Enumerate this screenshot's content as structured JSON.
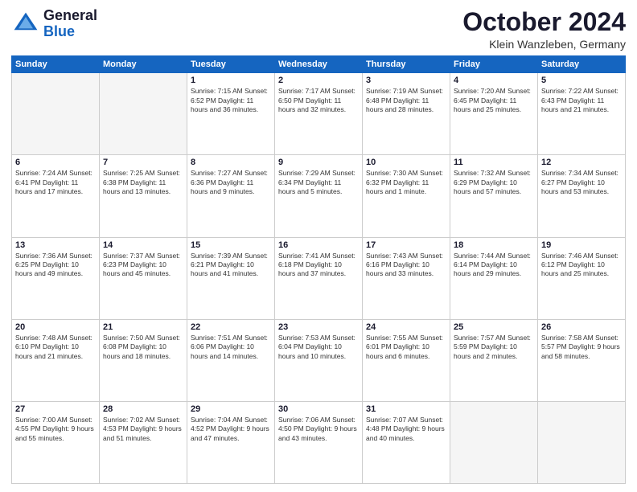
{
  "header": {
    "logo_general": "General",
    "logo_blue": "Blue",
    "month_title": "October 2024",
    "location": "Klein Wanzleben, Germany"
  },
  "weekdays": [
    "Sunday",
    "Monday",
    "Tuesday",
    "Wednesday",
    "Thursday",
    "Friday",
    "Saturday"
  ],
  "weeks": [
    [
      {
        "day": "",
        "info": ""
      },
      {
        "day": "",
        "info": ""
      },
      {
        "day": "1",
        "info": "Sunrise: 7:15 AM\nSunset: 6:52 PM\nDaylight: 11 hours\nand 36 minutes."
      },
      {
        "day": "2",
        "info": "Sunrise: 7:17 AM\nSunset: 6:50 PM\nDaylight: 11 hours\nand 32 minutes."
      },
      {
        "day": "3",
        "info": "Sunrise: 7:19 AM\nSunset: 6:48 PM\nDaylight: 11 hours\nand 28 minutes."
      },
      {
        "day": "4",
        "info": "Sunrise: 7:20 AM\nSunset: 6:45 PM\nDaylight: 11 hours\nand 25 minutes."
      },
      {
        "day": "5",
        "info": "Sunrise: 7:22 AM\nSunset: 6:43 PM\nDaylight: 11 hours\nand 21 minutes."
      }
    ],
    [
      {
        "day": "6",
        "info": "Sunrise: 7:24 AM\nSunset: 6:41 PM\nDaylight: 11 hours\nand 17 minutes."
      },
      {
        "day": "7",
        "info": "Sunrise: 7:25 AM\nSunset: 6:38 PM\nDaylight: 11 hours\nand 13 minutes."
      },
      {
        "day": "8",
        "info": "Sunrise: 7:27 AM\nSunset: 6:36 PM\nDaylight: 11 hours\nand 9 minutes."
      },
      {
        "day": "9",
        "info": "Sunrise: 7:29 AM\nSunset: 6:34 PM\nDaylight: 11 hours\nand 5 minutes."
      },
      {
        "day": "10",
        "info": "Sunrise: 7:30 AM\nSunset: 6:32 PM\nDaylight: 11 hours\nand 1 minute."
      },
      {
        "day": "11",
        "info": "Sunrise: 7:32 AM\nSunset: 6:29 PM\nDaylight: 10 hours\nand 57 minutes."
      },
      {
        "day": "12",
        "info": "Sunrise: 7:34 AM\nSunset: 6:27 PM\nDaylight: 10 hours\nand 53 minutes."
      }
    ],
    [
      {
        "day": "13",
        "info": "Sunrise: 7:36 AM\nSunset: 6:25 PM\nDaylight: 10 hours\nand 49 minutes."
      },
      {
        "day": "14",
        "info": "Sunrise: 7:37 AM\nSunset: 6:23 PM\nDaylight: 10 hours\nand 45 minutes."
      },
      {
        "day": "15",
        "info": "Sunrise: 7:39 AM\nSunset: 6:21 PM\nDaylight: 10 hours\nand 41 minutes."
      },
      {
        "day": "16",
        "info": "Sunrise: 7:41 AM\nSunset: 6:18 PM\nDaylight: 10 hours\nand 37 minutes."
      },
      {
        "day": "17",
        "info": "Sunrise: 7:43 AM\nSunset: 6:16 PM\nDaylight: 10 hours\nand 33 minutes."
      },
      {
        "day": "18",
        "info": "Sunrise: 7:44 AM\nSunset: 6:14 PM\nDaylight: 10 hours\nand 29 minutes."
      },
      {
        "day": "19",
        "info": "Sunrise: 7:46 AM\nSunset: 6:12 PM\nDaylight: 10 hours\nand 25 minutes."
      }
    ],
    [
      {
        "day": "20",
        "info": "Sunrise: 7:48 AM\nSunset: 6:10 PM\nDaylight: 10 hours\nand 21 minutes."
      },
      {
        "day": "21",
        "info": "Sunrise: 7:50 AM\nSunset: 6:08 PM\nDaylight: 10 hours\nand 18 minutes."
      },
      {
        "day": "22",
        "info": "Sunrise: 7:51 AM\nSunset: 6:06 PM\nDaylight: 10 hours\nand 14 minutes."
      },
      {
        "day": "23",
        "info": "Sunrise: 7:53 AM\nSunset: 6:04 PM\nDaylight: 10 hours\nand 10 minutes."
      },
      {
        "day": "24",
        "info": "Sunrise: 7:55 AM\nSunset: 6:01 PM\nDaylight: 10 hours\nand 6 minutes."
      },
      {
        "day": "25",
        "info": "Sunrise: 7:57 AM\nSunset: 5:59 PM\nDaylight: 10 hours\nand 2 minutes."
      },
      {
        "day": "26",
        "info": "Sunrise: 7:58 AM\nSunset: 5:57 PM\nDaylight: 9 hours\nand 58 minutes."
      }
    ],
    [
      {
        "day": "27",
        "info": "Sunrise: 7:00 AM\nSunset: 4:55 PM\nDaylight: 9 hours\nand 55 minutes."
      },
      {
        "day": "28",
        "info": "Sunrise: 7:02 AM\nSunset: 4:53 PM\nDaylight: 9 hours\nand 51 minutes."
      },
      {
        "day": "29",
        "info": "Sunrise: 7:04 AM\nSunset: 4:52 PM\nDaylight: 9 hours\nand 47 minutes."
      },
      {
        "day": "30",
        "info": "Sunrise: 7:06 AM\nSunset: 4:50 PM\nDaylight: 9 hours\nand 43 minutes."
      },
      {
        "day": "31",
        "info": "Sunrise: 7:07 AM\nSunset: 4:48 PM\nDaylight: 9 hours\nand 40 minutes."
      },
      {
        "day": "",
        "info": ""
      },
      {
        "day": "",
        "info": ""
      }
    ]
  ]
}
